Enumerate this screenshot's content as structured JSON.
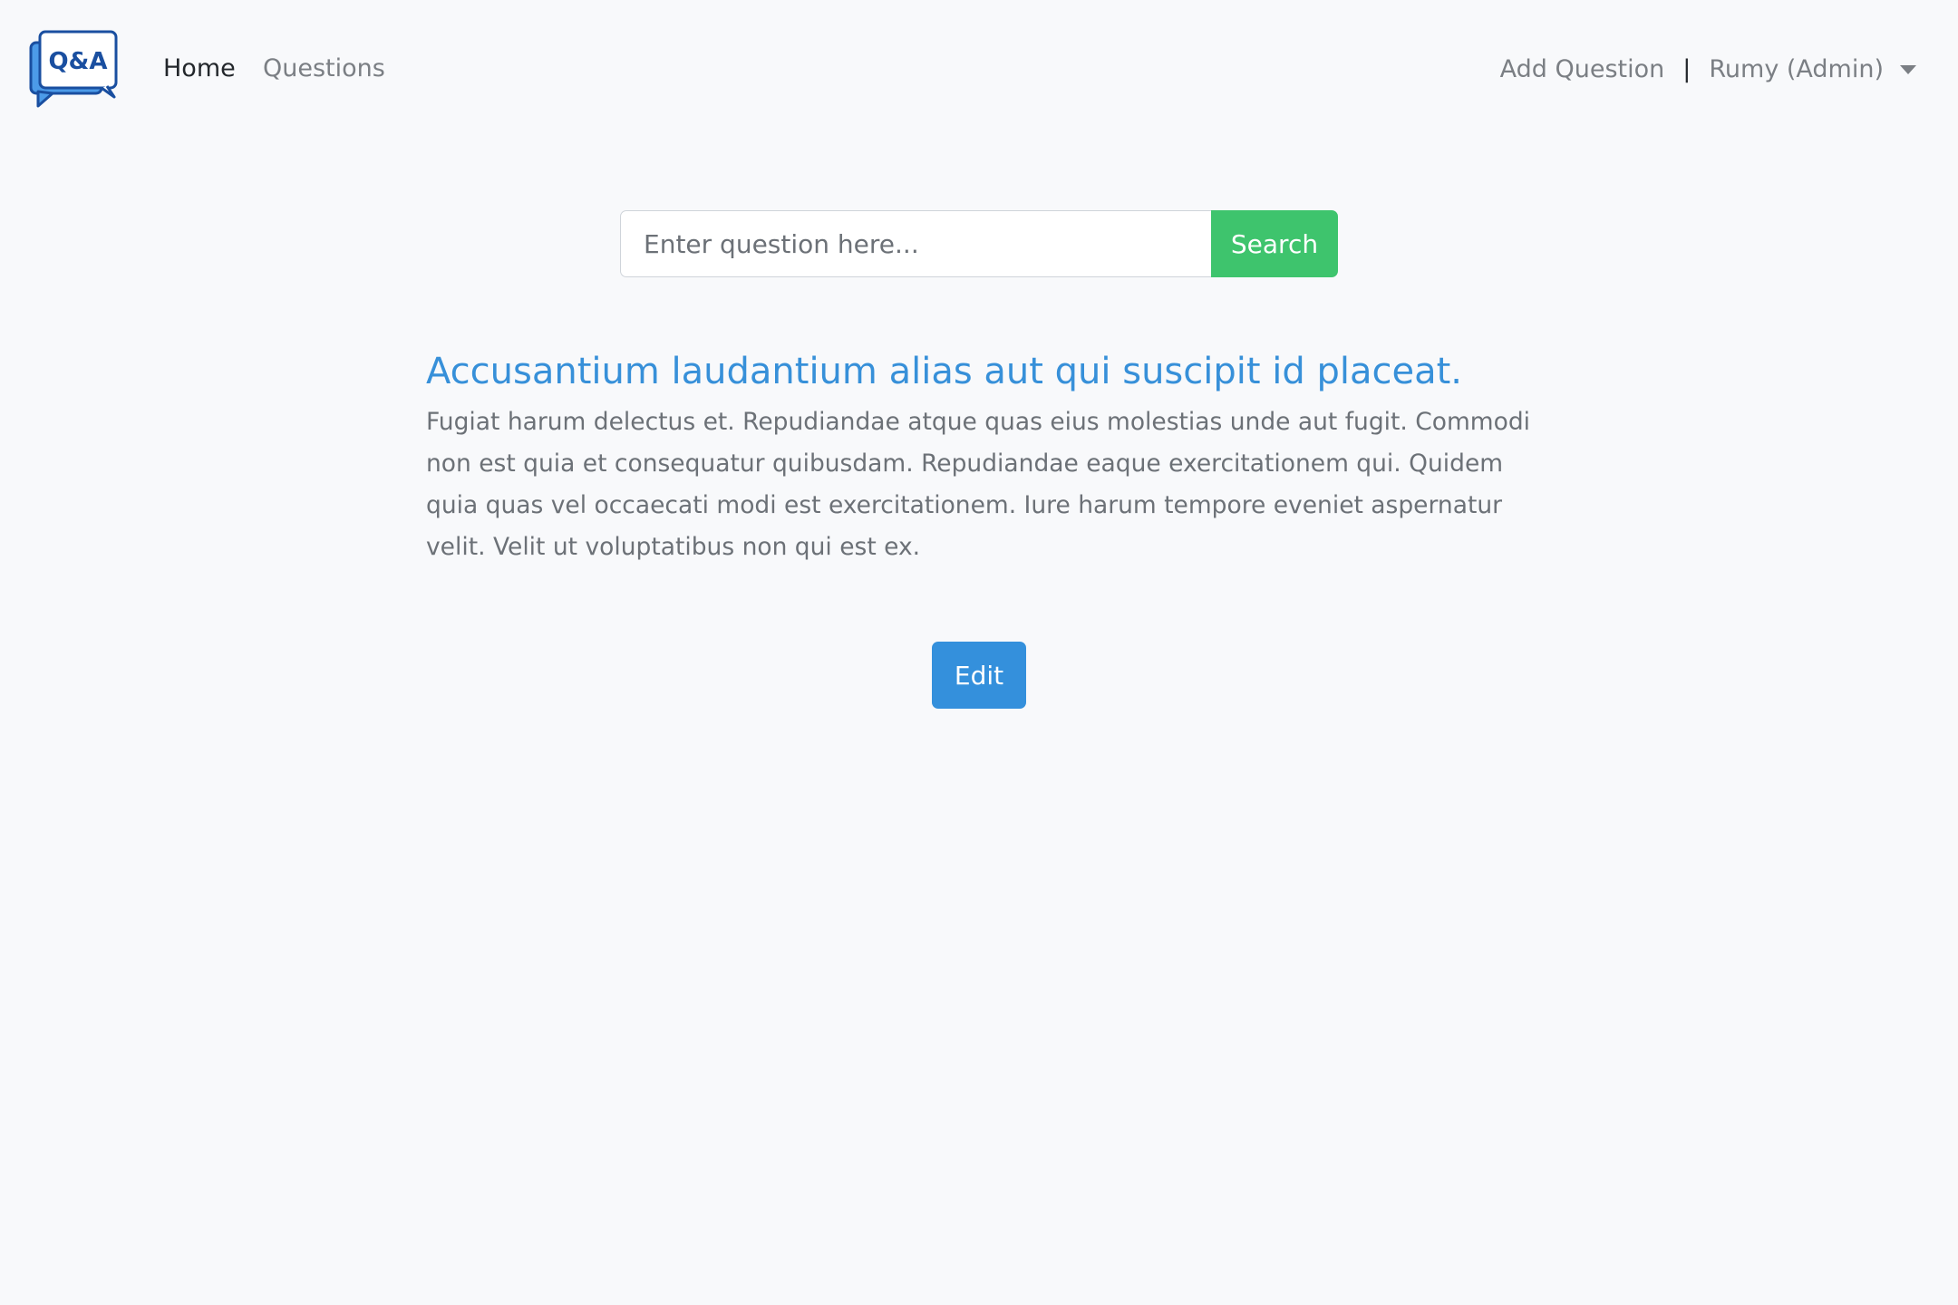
{
  "navbar": {
    "logo_text": "Q&A",
    "links": [
      {
        "label": "Home",
        "active": true
      },
      {
        "label": "Questions",
        "active": false
      }
    ],
    "add_question_label": "Add Question",
    "separator": "|",
    "user_label": "Rumy (Admin)",
    "logo_color": "#1a4fa0",
    "logo_fill": "#4c9be8"
  },
  "search": {
    "placeholder": "Enter question here...",
    "value": "",
    "button_label": "Search",
    "button_color": "#3ec46d"
  },
  "question": {
    "title": "Accusantium laudantium alias aut qui suscipit id placeat.",
    "body": "Fugiat harum delectus et. Repudiandae atque quas eius molestias unde aut fugit. Commodi non est quia et consequatur quibusdam. Repudiandae eaque exercitationem qui. Quidem quia quas vel occaecati modi est exercitationem. Iure harum tempore eveniet aspernatur velit. Velit ut voluptatibus non qui est ex.",
    "title_color": "#3790d9"
  },
  "actions": {
    "edit_label": "Edit",
    "edit_color": "#3490dc"
  }
}
